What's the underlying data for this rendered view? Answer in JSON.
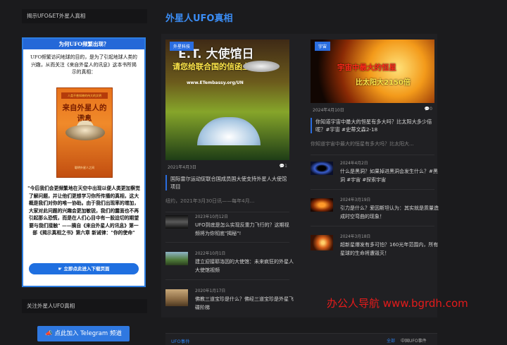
{
  "sidebar": {
    "header": "揭示UFO&ET外星人真相",
    "promo": {
      "title": "为何UFO频繁出现？",
      "intro": "UFO频繁访问地球的目的，是为了引起地球人类的兴趣，从而关注《来自外星人的讯息》这本书所揭示的真相：",
      "book": {
        "band": "人类不曾知晓的伟大的文明",
        "title": "来自外星人的讯息",
        "author": "雷尔 著",
        "publisher": "聪明外星人之间"
      },
      "quote": "\"今后我们会更频繁地在天空中出现以便人类更加察觉了解问题，并让他们更想学习你所传播的真相，这大概是我们对你的唯一协助。由于我们出现率的增加，大家对此问题的兴趣会更加敏锐，我们的露面也不再引起那么恐慌，而是在人们心目中有一股迫切的期望要与我们接触\" ——摘自《来自外星人的讯息》第一部《揭示真相之书》第六章 新诫律：\"你的使命\"",
      "button": "立即点此进入下载页面"
    },
    "header2": "关注外星人UFO真相",
    "telegram_button": "点此加入 Telegram 频道"
  },
  "main": {
    "title": "外星人UFO真相",
    "featured": [
      {
        "tag": "外星科技",
        "image_title": "E.T. 大使馆日",
        "image_subtitle": "请您给联合国的信函上签名：",
        "image_url": "www.ETembassy.org/UN",
        "date": "2021年4月3日",
        "comments": "1",
        "title": "国际雷尔运动促联合国成员国大使支持外星人大使馆项目",
        "excerpt": "纽约，2021年3月30日讯——每年4月..."
      },
      {
        "tag": "宇宙",
        "image_line1": "宇宙中最大的恒星",
        "image_line2": "比太阳大2150倍",
        "date": "2024年4月10日",
        "comments": "0",
        "title": "你知道宇宙中最大的恒星有多大吗？比太阳大多少倍呢？#宇宙 #史蒂文森2-18",
        "excerpt": "你知道宇宙中最大的恒星有多大吗？比太阳大..."
      }
    ],
    "list_left": [
      {
        "date": "2023年10月12日",
        "title": "UFO到底是怎么实现反重力飞行的？这期视频将为你彻底\"揭秘\"!"
      },
      {
        "date": "2022年10月1日",
        "title": "建立迎接耶洛因的大使馆：未来疯狂的外星人大使馆视频"
      },
      {
        "date": "2020年1月17日",
        "title": "佛教三道宝珍是什么？佛经三道宝珍是外星飞碟阶梯"
      }
    ],
    "list_right": [
      {
        "date": "2024年4月2日",
        "title": "什么是黑洞？如果掉进黑洞会发生什么？#黑洞 #宇宙 #探索宇宙"
      },
      {
        "date": "2024年3月19日",
        "title": "引力是什么？爱因斯坦认为：其实就是质量造成时空弯曲的现象！"
      },
      {
        "date": "2024年3月18日",
        "title": "超新星爆发有多可怕？160光年范围内，所有星球的生命将遭毁灭！"
      }
    ]
  },
  "watermark": "办公人导航 www.bgrdh.com",
  "bottom": {
    "title": "UFO事件",
    "link_all": "全部",
    "link_cn": "中国UFO事件"
  }
}
